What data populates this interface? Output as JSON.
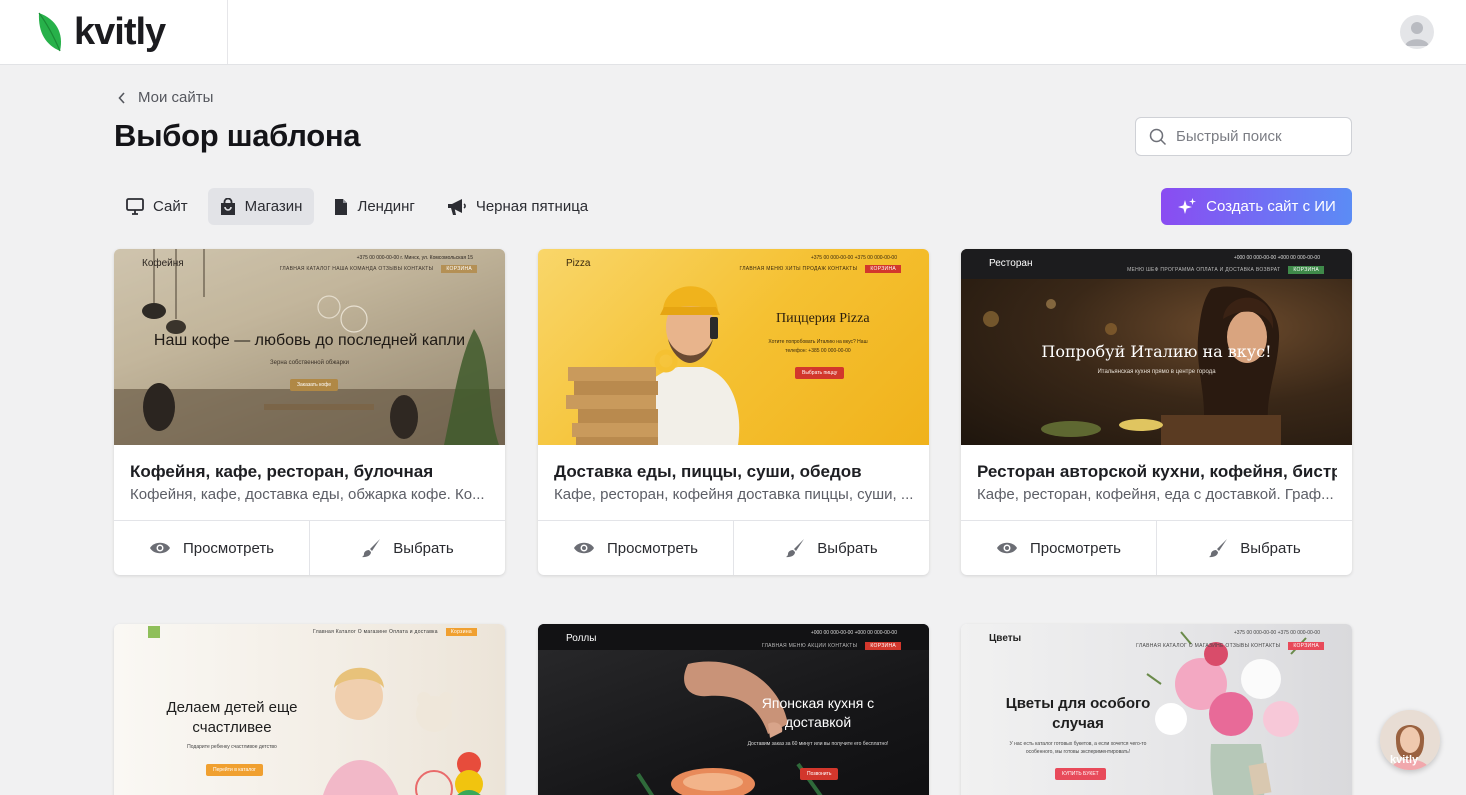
{
  "header": {
    "logo_text": "kvitly"
  },
  "breadcrumb": {
    "label": "Мои сайты"
  },
  "page_title": "Выбор шаблона",
  "search": {
    "placeholder": "Быстрый поиск"
  },
  "tabs": [
    {
      "label": "Сайт",
      "icon": "monitor-icon",
      "active": false
    },
    {
      "label": "Магазин",
      "icon": "shopping-bag-icon",
      "active": true
    },
    {
      "label": "Лендинг",
      "icon": "document-icon",
      "active": false
    },
    {
      "label": "Черная пятница",
      "icon": "megaphone-icon",
      "active": false
    }
  ],
  "ai_button": {
    "label": "Создать сайт с ИИ"
  },
  "actions": {
    "preview": "Просмотреть",
    "select": "Выбрать"
  },
  "cards": [
    {
      "title": "Кофейня, кафе, ресторан, булочная",
      "desc": "Кофейня, кафе, доставка еды, обжарка кофе. Ко...",
      "thumb": {
        "brand": "Кофейня",
        "phone": "+375 00 000-00-00   г. Минск, ул. Комсомольская 15",
        "links": "ГЛАВНАЯ   КАТАЛОГ   НАША КОМАНДА   ОТЗЫВЫ   КОНТАКТЫ",
        "cart": "КОРЗИНА",
        "headline": "Наш кофе — любовь до последней капли",
        "sub": "Зерна собственной обжарки",
        "cta": "Заказать кофе"
      }
    },
    {
      "title": "Доставка еды, пиццы, суши, обедов",
      "desc": "Кафе, ресторан, кофейня доставка пиццы, суши, ...",
      "thumb": {
        "brand": "Pizza",
        "phone": "+375 00 000-00-00   +375 00 000-00-00",
        "links": "ГЛАВНАЯ   МЕНЮ   ХИТЫ ПРОДАЖ   КОНТАКТЫ",
        "cart": "КОРЗИНА",
        "headline": "Пиццерия Pizza",
        "sub": "Хотите попробовать Италию на вкус? Наш телефон: +385 00 000-00-00",
        "cta": "Выбрать пиццу"
      }
    },
    {
      "title": "Ресторан авторской кухни, кофейня, бистро",
      "desc": "Кафе, ресторан, кофейня, еда с доставкой. Граф...",
      "thumb": {
        "brand": "Ресторан",
        "phone": "+000 00 000-00-00   +000 00 000-00-00",
        "links": "МЕНЮ   ШЕФ   ПРОГРАММА   ОПЛАТА И ДОСТАВКА   ВОЗВРАТ",
        "cart": "КОРЗИНА",
        "headline": "Попробуй Италию на вкус!",
        "sub": "Итальянская кухня прямо в центре города",
        "cta": ""
      }
    },
    {
      "title": "",
      "desc": "",
      "thumb": {
        "brand": "",
        "phone": "",
        "links": "Главная   Каталог   О магазине   Оплата и доставка",
        "cart": "Корзина",
        "headline": "Делаем детей еще счастливее",
        "sub": "Подарите ребенку счастливое детство",
        "cta": "Перейти в каталог"
      }
    },
    {
      "title": "",
      "desc": "",
      "thumb": {
        "brand": "Роллы",
        "phone": "+000 00 000-00-00   +000 00 000-00-00",
        "links": "ГЛАВНАЯ   МЕНЮ   АКЦИИ   КОНТАКТЫ",
        "cart": "КОРЗИНА",
        "headline": "Японская кухня с доставкой",
        "sub": "Доставим заказ за 60 минут или вы получите его бесплатно!",
        "cta": "Позвонить"
      }
    },
    {
      "title": "",
      "desc": "",
      "thumb": {
        "brand": "Цветы",
        "phone": "+375 00 000-00-00   +375 00 000-00-00",
        "links": "ГЛАВНАЯ   КАТАЛОГ   О МАГАЗИНЕ   ОТЗЫВЫ   КОНТАКТЫ",
        "cart": "КОРЗИНА",
        "headline": "Цветы для особого случая",
        "sub": "У нас есть каталог готовых букетов, а если хочется чего-то особенного, мы готовы экспериментировать!",
        "cta": "КУПИТЬ БУКЕТ"
      }
    }
  ],
  "chat_widget": {
    "label": "kvitly"
  }
}
